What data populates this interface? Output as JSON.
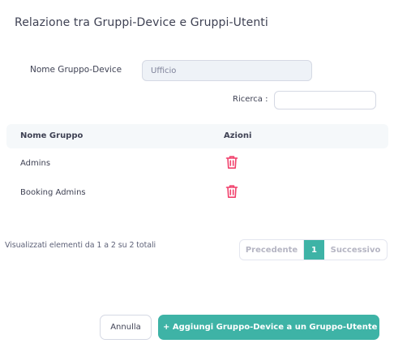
{
  "dialog": {
    "title": "Relazione tra Gruppi-Device e Gruppi-Utenti"
  },
  "form": {
    "device_group_label": "Nome Gruppo-Device",
    "device_group_value": "Ufficio",
    "search_label": "Ricerca :",
    "search_value": ""
  },
  "table": {
    "headers": {
      "name": "Nome Gruppo",
      "actions": "Azioni"
    },
    "rows": [
      {
        "name": "Admins",
        "action_icon": "trash-icon"
      },
      {
        "name": "Booking Admins",
        "action_icon": "trash-icon"
      }
    ]
  },
  "pagination": {
    "info": "Visualizzati elementi da 1 a 2 su 2 totali",
    "previous": "Precedente",
    "current": "1",
    "next": "Successivo"
  },
  "footer": {
    "cancel_label": "Annulla",
    "add_label": "+ Aggiungi Gruppo-Device a un Gruppo-Utente"
  },
  "colors": {
    "accent": "#3eb3a6",
    "danger": "#f1416c",
    "header_bg": "#f5f8fa"
  }
}
